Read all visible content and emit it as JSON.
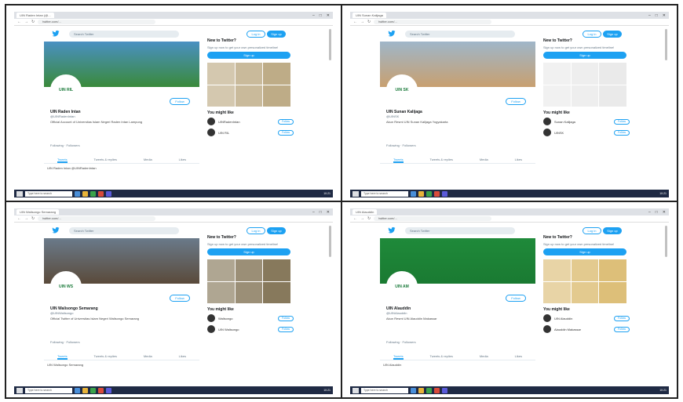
{
  "panels": [
    {
      "id": "panel-1",
      "browser": {
        "tab_title": "UIN Raden Intan (@...",
        "url": "twitter.com/...",
        "window_controls": [
          "–",
          "□",
          "✕"
        ]
      },
      "header": {
        "search_placeholder": "Search Twitter",
        "login": "Log in",
        "signup": "Sign up"
      },
      "profile": {
        "name": "UIN Raden Intan",
        "handle": "@UINRadenIntan",
        "bio": "Official Account of Universitas Islam Negeri Raden Intan Lampung",
        "stats": "Following · Followers",
        "follow": "Follow",
        "avatar_text": "UIN RIL"
      },
      "tabs": [
        "Tweets",
        "Tweets & replies",
        "Media",
        "Likes"
      ],
      "tweet": "UIN Raden Intan @UINRadenIntan",
      "sidebar": {
        "title": "New to Twitter?",
        "subtitle": "Sign up now to get your own personalized timeline!",
        "button": "Sign up",
        "likes_title": "You might like",
        "likes": [
          "UINRadenIntan",
          "UIN RIL"
        ],
        "follow": "Follow"
      },
      "colors": {
        "banner_top": "#4a90c2",
        "banner_bottom": "#3a8a3a",
        "media": "#b7a37a"
      }
    },
    {
      "id": "panel-2",
      "browser": {
        "tab_title": "UIN Sunan Kalijaga",
        "url": "twitter.com/...",
        "window_controls": [
          "–",
          "□",
          "✕"
        ]
      },
      "header": {
        "search_placeholder": "Search Twitter",
        "login": "Log in",
        "signup": "Sign up"
      },
      "profile": {
        "name": "UIN Sunan Kalijaga",
        "handle": "@UINSK",
        "bio": "Akun Resmi UIN Sunan Kalijaga Yogyakarta",
        "stats": "Following · Followers",
        "follow": "Follow",
        "avatar_text": "UIN SK"
      },
      "tabs": [
        "Tweets",
        "Tweets & replies",
        "Media",
        "Likes"
      ],
      "tweet": "",
      "sidebar": {
        "title": "New to Twitter?",
        "subtitle": "Sign up now to get your own personalized timeline!",
        "button": "Sign up",
        "likes_title": "You might like",
        "likes": [
          "Sunan Kalijaga",
          "UINSK"
        ],
        "follow": "Follow"
      },
      "colors": {
        "banner_top": "#9fb6c9",
        "banner_bottom": "#c8a070",
        "media": "#e8e8e8"
      }
    },
    {
      "id": "panel-3",
      "browser": {
        "tab_title": "UIN Walisongo Semarang",
        "url": "twitter.com/...",
        "window_controls": [
          "–",
          "□",
          "✕"
        ]
      },
      "header": {
        "search_placeholder": "Search Twitter",
        "login": "Log in",
        "signup": "Sign up"
      },
      "profile": {
        "name": "UIN Walisongo Semarang",
        "handle": "@UINWalisongo",
        "bio": "Official Twitter of Universitas Islam Negeri Walisongo Semarang",
        "stats": "Following · Followers",
        "follow": "Follow",
        "avatar_text": "UIN WS"
      },
      "tabs": [
        "Tweets",
        "Tweets & replies",
        "Media",
        "Likes"
      ],
      "tweet": "UIN Walisongo Semarang",
      "sidebar": {
        "title": "New to Twitter?",
        "subtitle": "Sign up now to get your own personalized timeline!",
        "button": "Sign up",
        "likes_title": "You might like",
        "likes": [
          "Walisongo",
          "UIN Walisongo"
        ],
        "follow": "Follow"
      },
      "colors": {
        "banner_top": "#6a7a8a",
        "banner_bottom": "#5a4a3a",
        "media": "#7a6a4a"
      }
    },
    {
      "id": "panel-4",
      "browser": {
        "tab_title": "UIN Alauddin",
        "url": "twitter.com/...",
        "window_controls": [
          "–",
          "□",
          "✕"
        ]
      },
      "header": {
        "search_placeholder": "Search Twitter",
        "login": "Log in",
        "signup": "Sign up"
      },
      "profile": {
        "name": "UIN Alauddin",
        "handle": "@UINAlauddin",
        "bio": "Akun Resmi UIN Alauddin Makassar",
        "stats": "Following · Followers",
        "follow": "Follow",
        "avatar_text": "UIN AM"
      },
      "tabs": [
        "Tweets",
        "Tweets & replies",
        "Media",
        "Likes"
      ],
      "tweet": "UIN Alauddin",
      "sidebar": {
        "title": "New to Twitter?",
        "subtitle": "Sign up now to get your own personalized timeline!",
        "button": "Sign up",
        "likes_title": "You might like",
        "likes": [
          "UIN Alauddin",
          "Alauddin Makassar"
        ],
        "follow": "Follow"
      },
      "colors": {
        "banner_top": "#1f8a3a",
        "banner_bottom": "#1a7a32",
        "media": "#d9b86a"
      }
    }
  ],
  "taskbar": {
    "search": "Type here to search",
    "clock": "10:21"
  }
}
